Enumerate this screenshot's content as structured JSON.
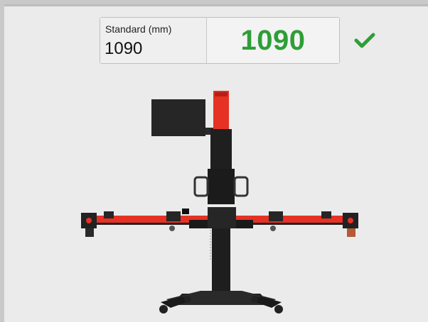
{
  "standard": {
    "label": "Standard (mm)",
    "value": "1090"
  },
  "measured": {
    "value": "1090",
    "status_icon": "checkmark-icon",
    "status_color": "#2e9e37"
  },
  "colors": {
    "frame_bg": "#ebebeb",
    "accent_red": "#e53224",
    "frame_black": "#1e1e1e"
  }
}
